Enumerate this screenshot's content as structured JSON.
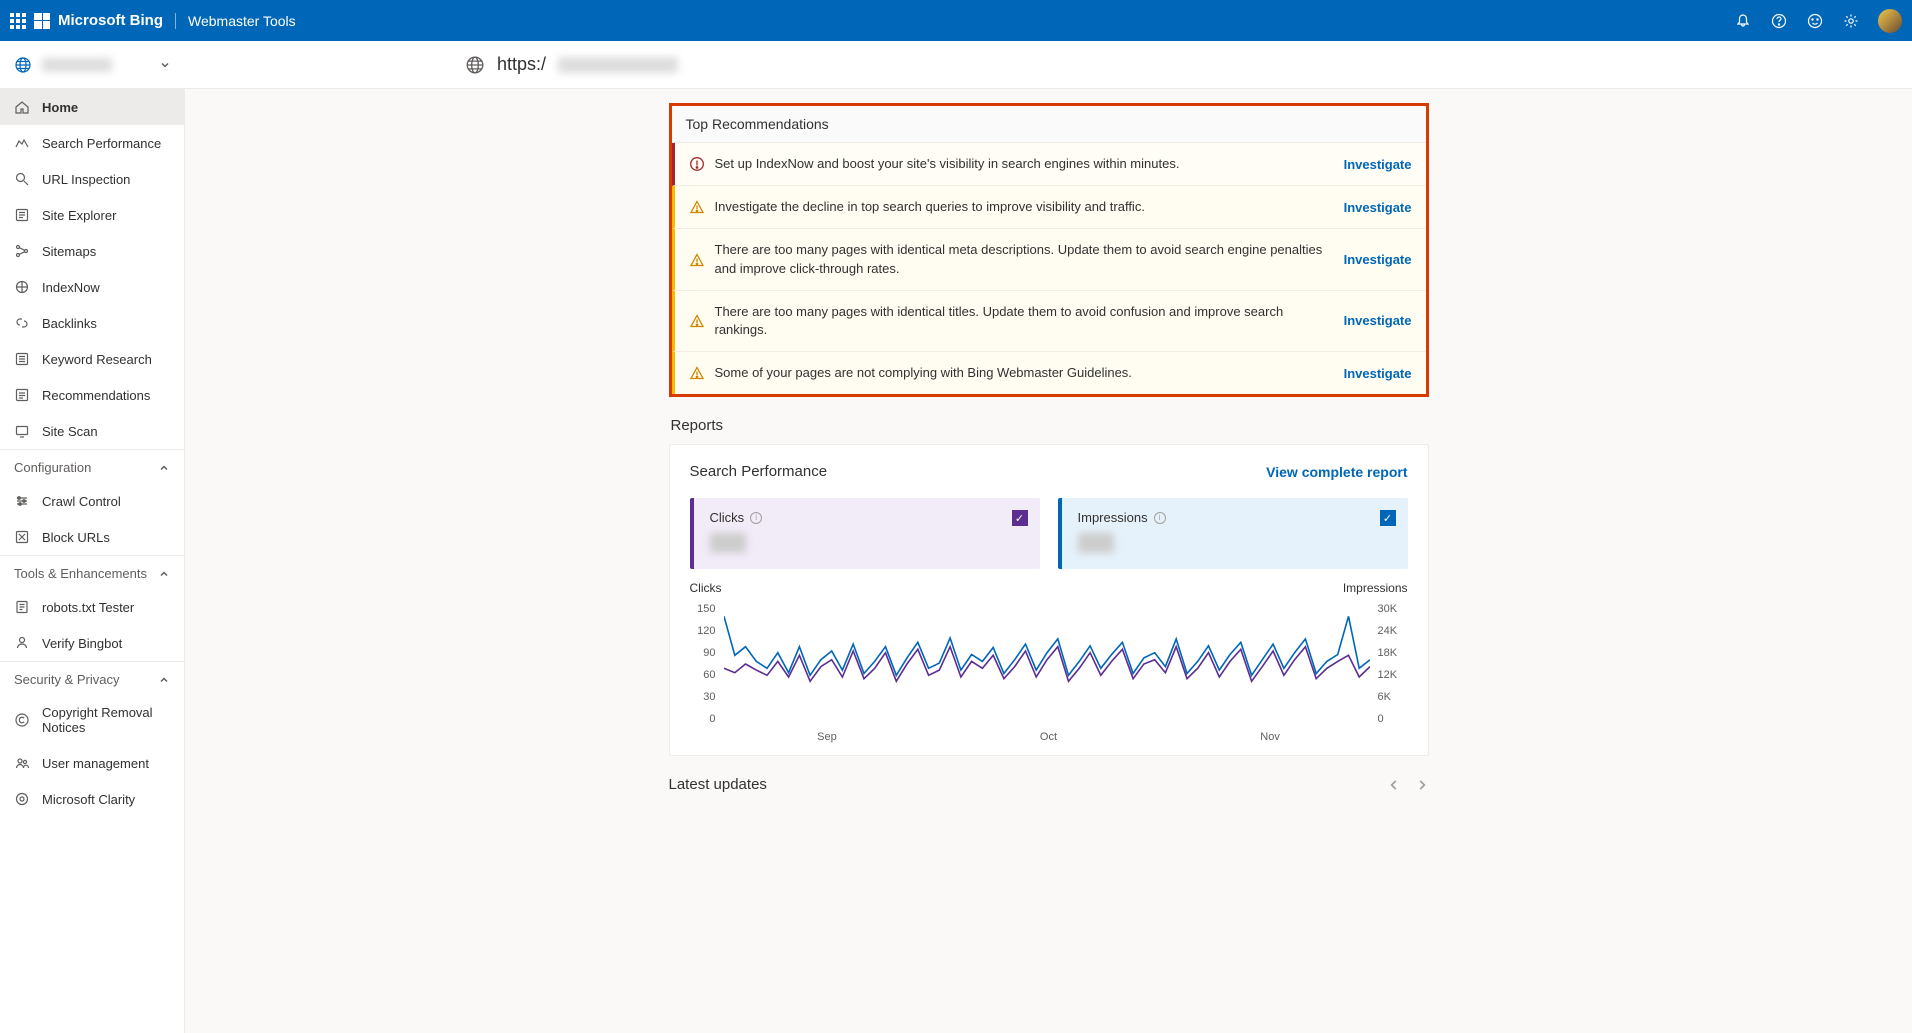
{
  "header": {
    "brand": "Microsoft Bing",
    "product": "Webmaster Tools"
  },
  "site_selector": {
    "url_prefix": "https:/"
  },
  "sidebar": {
    "items": [
      {
        "label": "Home",
        "active": true
      },
      {
        "label": "Search Performance"
      },
      {
        "label": "URL Inspection"
      },
      {
        "label": "Site Explorer"
      },
      {
        "label": "Sitemaps"
      },
      {
        "label": "IndexNow"
      },
      {
        "label": "Backlinks"
      },
      {
        "label": "Keyword Research"
      },
      {
        "label": "Recommendations"
      },
      {
        "label": "Site Scan"
      }
    ],
    "sections": [
      {
        "label": "Configuration",
        "items": [
          "Crawl Control",
          "Block URLs"
        ]
      },
      {
        "label": "Tools & Enhancements",
        "items": [
          "robots.txt Tester",
          "Verify Bingbot"
        ]
      },
      {
        "label": "Security & Privacy",
        "items": [
          "Copyright Removal Notices",
          "User management",
          "Microsoft Clarity"
        ]
      }
    ]
  },
  "recommendations": {
    "title": "Top Recommendations",
    "investigate_label": "Investigate",
    "rows": [
      {
        "severity": "error",
        "text": "Set up IndexNow and boost your site's visibility in search engines within minutes."
      },
      {
        "severity": "warn",
        "text": "Investigate the decline in top search queries to improve visibility and traffic."
      },
      {
        "severity": "warn",
        "text": "There are too many pages with identical meta descriptions. Update them to avoid search engine penalties and improve click-through rates."
      },
      {
        "severity": "warn",
        "text": "There are too many pages with identical titles. Update them to avoid confusion and improve search rankings."
      },
      {
        "severity": "warn",
        "text": "Some of your pages are not complying with Bing Webmaster Guidelines."
      }
    ]
  },
  "reports": {
    "title": "Reports",
    "search_performance": {
      "title": "Search Performance",
      "view_link": "View complete report",
      "metrics": {
        "clicks_label": "Clicks",
        "impressions_label": "Impressions"
      },
      "axis_left_label": "Clicks",
      "axis_right_label": "Impressions"
    }
  },
  "latest_updates": {
    "title": "Latest updates"
  },
  "chart_data": {
    "type": "line",
    "xlabel": "",
    "ylabel_left": "Clicks",
    "ylabel_right": "Impressions",
    "ylim_left": [
      0,
      150
    ],
    "ylim_right": [
      0,
      30000
    ],
    "y_ticks_left": [
      150,
      120,
      90,
      60,
      30,
      0
    ],
    "y_ticks_right": [
      "30K",
      "24K",
      "18K",
      "12K",
      "6K",
      "0"
    ],
    "x_ticks": [
      "Sep",
      "Oct",
      "Nov"
    ],
    "series": [
      {
        "name": "Clicks",
        "color": "#5c2e91",
        "values": [
          70,
          65,
          75,
          68,
          62,
          78,
          60,
          85,
          55,
          72,
          80,
          60,
          90,
          58,
          70,
          88,
          55,
          75,
          92,
          62,
          68,
          95,
          60,
          78,
          70,
          85,
          58,
          72,
          90,
          60,
          80,
          95,
          55,
          70,
          88,
          62,
          78,
          92,
          58,
          75,
          80,
          65,
          95,
          58,
          70,
          88,
          60,
          78,
          92,
          55,
          72,
          90,
          62,
          80,
          95,
          58,
          70,
          78,
          85,
          60,
          72
        ]
      },
      {
        "name": "Impressions",
        "color": "#0067b8",
        "values": [
          130,
          85,
          95,
          78,
          70,
          88,
          65,
          95,
          62,
          80,
          90,
          68,
          98,
          64,
          78,
          95,
          62,
          82,
          100,
          70,
          76,
          105,
          68,
          86,
          78,
          94,
          64,
          80,
          98,
          68,
          88,
          104,
          62,
          78,
          96,
          70,
          86,
          100,
          64,
          82,
          88,
          72,
          104,
          64,
          78,
          96,
          68,
          86,
          100,
          62,
          80,
          98,
          70,
          88,
          104,
          64,
          78,
          86,
          130,
          70,
          80
        ]
      }
    ]
  }
}
